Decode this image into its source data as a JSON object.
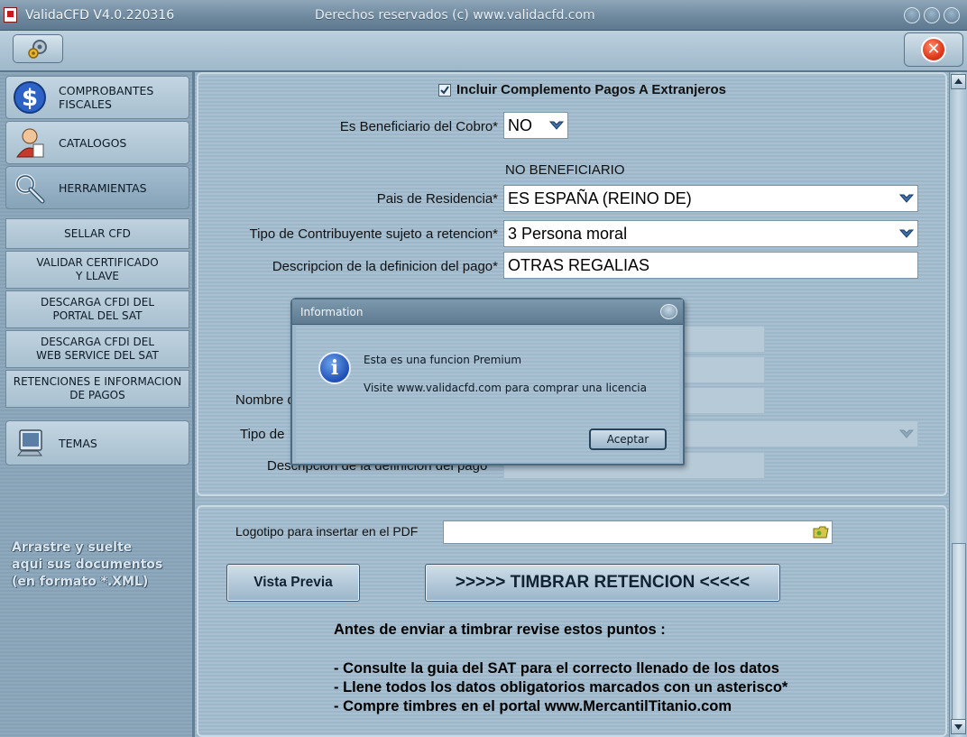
{
  "window": {
    "title": "ValidaCFD V4.0.220316",
    "rights": "Derechos reservados (c) www.validacfd.com"
  },
  "sidebar": {
    "nav": [
      {
        "label_line1": "COMPROBANTES",
        "label_line2": "FISCALES",
        "icon": "dollar-icon"
      },
      {
        "label_line1": "CATALOGOS",
        "label_line2": "",
        "icon": "user-catalog-icon"
      },
      {
        "label_line1": "HERRAMIENTAS",
        "label_line2": "",
        "icon": "tools-icon"
      },
      {
        "label_line1": "TEMAS",
        "label_line2": "",
        "icon": "monitor-icon"
      }
    ],
    "tools": [
      {
        "line1": "SELLAR CFD",
        "line2": ""
      },
      {
        "line1": "VALIDAR CERTIFICADO",
        "line2": "Y LLAVE"
      },
      {
        "line1": "DESCARGA CFDI DEL",
        "line2": "PORTAL DEL SAT"
      },
      {
        "line1": "DESCARGA CFDI DEL",
        "line2": "WEB SERVICE DEL SAT"
      },
      {
        "line1": "RETENCIONES E INFORMACION",
        "line2": "DE PAGOS"
      }
    ],
    "drop_text": [
      "Arrastre y suelte",
      "aqui sus documentos",
      "(en formato *.XML)"
    ]
  },
  "form": {
    "checkbox_label": "Incluir Complemento Pagos A Extranjeros",
    "checkbox_checked": true,
    "beneficiario_label": "Es Beneficiario del Cobro*",
    "beneficiario_value": "NO",
    "section_label": "NO BENEFICIARIO",
    "pais_label": "Pais de Residencia*",
    "pais_value": "ES  ESPAÑA (REINO DE)",
    "tipo_label": "Tipo de Contribuyente sujeto a retencion*",
    "tipo_value": "3 Persona moral",
    "desc_label": "Descripcion de la definicion del pago*",
    "desc_value": "OTRAS REGALIAS",
    "nombre_label_partial": "Nombre d",
    "tipo2_label_partial": "Tipo de",
    "desc2_label_partial": "Descripcion de la definicion del pago"
  },
  "bottom": {
    "logo_label": "Logotipo para insertar en el PDF",
    "logo_value": "",
    "preview_button": "Vista Previa",
    "stamp_button": ">>>>> TIMBRAR RETENCION <<<<<",
    "notes_title": "Antes de enviar a timbrar revise estos puntos :",
    "notes": [
      "- Consulte la guia del SAT para el correcto llenado de los datos",
      "- Llene todos los datos obligatorios marcados con un asterisco*",
      "- Compre timbres en el portal www.MercantilTitanio.com"
    ]
  },
  "dialog": {
    "title": "Information",
    "message1": "Esta es una funcion Premium",
    "message2": "Visite www.validacfd.com para comprar una licencia",
    "ok_button": "Aceptar"
  }
}
